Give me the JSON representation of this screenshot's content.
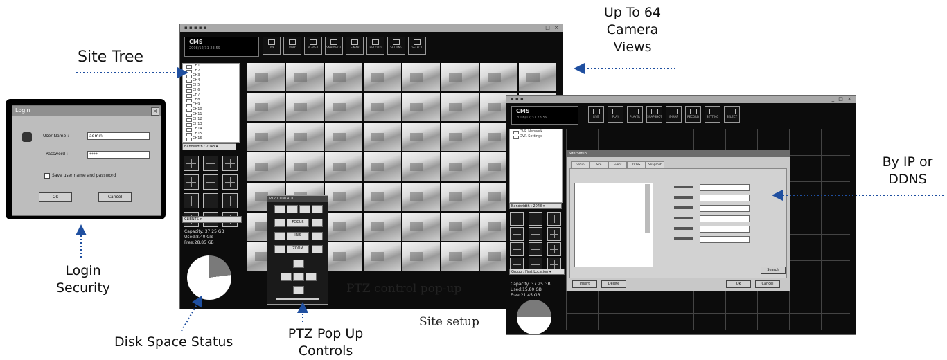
{
  "captions": {
    "site_tree": "Site Tree",
    "camera_views": [
      "Up To 64",
      "Camera",
      "Views"
    ],
    "by_ip": [
      "By IP or",
      "DDNS"
    ],
    "login_security": [
      "Login",
      "Security"
    ],
    "disk_space": "Disk Space Status",
    "ptz_popup_controls": [
      "PTZ Pop Up",
      "Controls"
    ],
    "ptz_control_popup": "PTZ control pop-up",
    "site_setup": "Site setup"
  },
  "login": {
    "title": "Login",
    "user_name_label": "User Name :",
    "user_name_value": "admin",
    "password_label": "Password :",
    "password_value": "****",
    "save_label": "Save user name and password",
    "ok": "Ok",
    "cancel": "Cancel"
  },
  "cms_main": {
    "logo_title": "CMS",
    "toolbar": [
      "LIVE",
      "PLAY",
      "PLAYER",
      "SNAPSHOT",
      "E-MAP",
      "RECORD",
      "SETTING",
      "SELECT"
    ],
    "tree_items": [
      "CH1",
      "CH2",
      "CH3",
      "CH4",
      "CH5",
      "CH6",
      "CH7",
      "CH8",
      "CH9",
      "CH10",
      "CH11",
      "CH12",
      "CH13",
      "CH14",
      "CH15",
      "CH16"
    ],
    "ptz_title": "PTZ CONTROL",
    "ptz_keys": [
      "FOCUS",
      "IRIS",
      "ZOOM"
    ],
    "disk_capacity": "Capacity: 37.25 GB",
    "disk_used": "Used:8.40 GB",
    "disk_free": "Free:28.85 GB",
    "used_fraction": 0.23
  },
  "cms_site": {
    "logo_title": "CMS",
    "toolbar": [
      "LIVE",
      "PLAY",
      "PLAYER",
      "SNAPSHOT",
      "E-MAP",
      "RECORD",
      "SETTING",
      "SELECT"
    ],
    "tree_items": [
      "DVR Network",
      "DVR Settings"
    ],
    "dialog_title": "Site Setup",
    "dialog_tabs": [
      "Group",
      "Site",
      "Event",
      "DDNS",
      "Snapshot"
    ],
    "dialog_buttons": [
      "Insert",
      "Delete",
      "Ok",
      "Cancel",
      "Search"
    ],
    "disk_capacity": "Capacity: 37.25 GB",
    "disk_used": "Used:15.80 GB",
    "disk_free": "Free:21.45 GB",
    "used_fraction": 0.5
  },
  "colors": {
    "arrow": "#1f4fa0",
    "pie_used": "#7a7a7a",
    "pie_free": "#ffffff"
  }
}
